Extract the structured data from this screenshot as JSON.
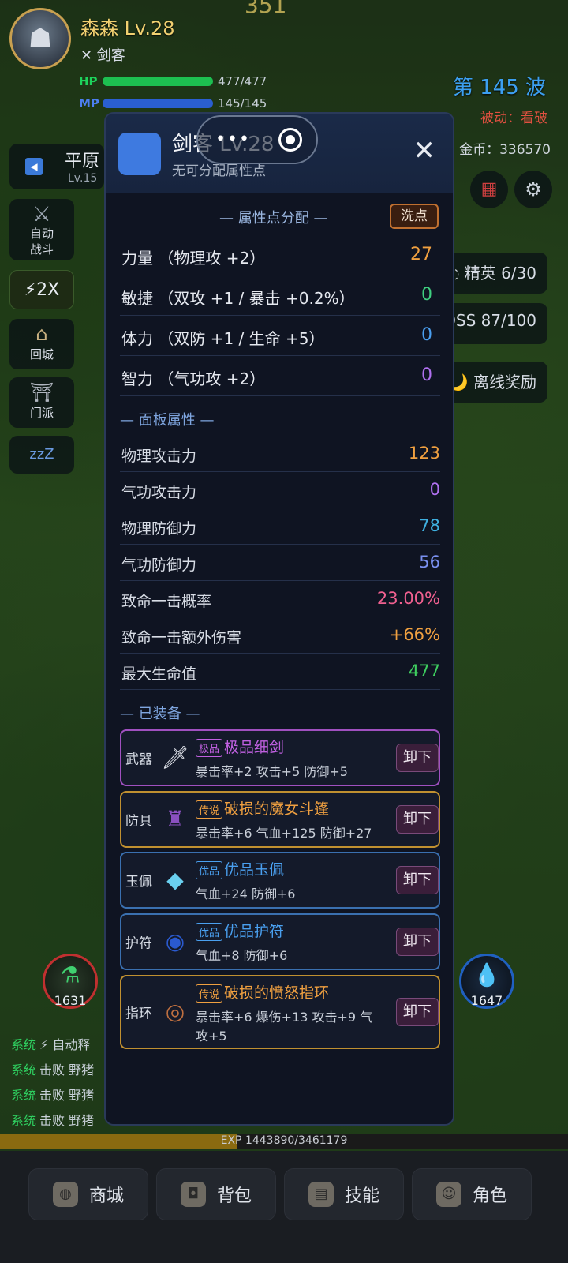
{
  "hud": {
    "gold_top": "351",
    "player_name": "森森 Lv.28",
    "player_class": "✕ 剑客",
    "hp_label": "HP",
    "hp_text": "477/477",
    "hp_fraction": 1.0,
    "mp_label": "MP",
    "mp_text": "145/145",
    "mp_fraction": 1.0,
    "wave": "第 145 波",
    "passive": "被动：看破",
    "coins": "金币：336570",
    "zone_name": "平原",
    "zone_level": "Lv.15"
  },
  "left_buttons": {
    "auto_battle": "自动\n战斗",
    "speed": "⚡2X",
    "return_city": "回城",
    "sect": "门派",
    "sleep": "zzZ"
  },
  "right_buttons": {
    "elite": "◌ 精英 6/30",
    "boss": "OSS 87/100",
    "offline": "🌙 离线奖励"
  },
  "potions": {
    "red_count": "1631",
    "blue_count": "1647"
  },
  "logs": [
    {
      "tag": "系统",
      "text": "⚡ 自动释"
    },
    {
      "tag": "系统",
      "text": "击败 野猪"
    },
    {
      "tag": "系统",
      "text": "击败 野猪"
    },
    {
      "tag": "系统",
      "text": "击败 野猪"
    }
  ],
  "exp": {
    "text": "EXP 1443890/3461179",
    "fraction": 0.417
  },
  "nav": [
    {
      "label": "商城",
      "icon": "bag-icon"
    },
    {
      "label": "背包",
      "icon": "backpack-icon"
    },
    {
      "label": "技能",
      "icon": "book-icon"
    },
    {
      "label": "角色",
      "icon": "person-icon"
    }
  ],
  "modal": {
    "title": "剑客 Lv.28",
    "subtitle": "无可分配属性点",
    "attr_section": "— 属性点分配 —",
    "wash_label": "洗点",
    "attrs": [
      {
        "label": "力量 （物理攻 +2）",
        "value": "27",
        "color": "#f0a040"
      },
      {
        "label": "敏捷 （双攻 +1 / 暴击 +0.2%）",
        "value": "0",
        "color": "#3fcf80"
      },
      {
        "label": "体力 （双防 +1 / 生命 +5）",
        "value": "0",
        "color": "#4a9ff0"
      },
      {
        "label": "智力 （气功攻 +2）",
        "value": "0",
        "color": "#b070f0"
      }
    ],
    "panel_section": "— 面板属性 —",
    "panel": [
      {
        "label": "物理攻击力",
        "value": "123",
        "color": "#f0a040"
      },
      {
        "label": "气功攻击力",
        "value": "0",
        "color": "#b070f0"
      },
      {
        "label": "物理防御力",
        "value": "78",
        "color": "#3fb0e0"
      },
      {
        "label": "气功防御力",
        "value": "56",
        "color": "#7a90f0"
      },
      {
        "label": "致命一击概率",
        "value": "23.00%",
        "color": "#f06090"
      },
      {
        "label": "致命一击额外伤害",
        "value": "+66%",
        "color": "#f0a040"
      },
      {
        "label": "最大生命值",
        "value": "477",
        "color": "#3fcf60"
      }
    ],
    "equip_section": "— 已装备 —",
    "unequip_label": "卸下",
    "equips": [
      {
        "slot": "武器",
        "icon": "dagger-icon",
        "rarity": "极品",
        "name": "极品细剑",
        "attrs": "暴击率+2  攻击+5  防御+5",
        "color": "#c060e0",
        "border": "#a050c0"
      },
      {
        "slot": "防具",
        "icon": "cloak-icon",
        "rarity": "传说",
        "name": "破损的魔女斗篷",
        "attrs": "暴击率+6  气血+125  防御+27",
        "color": "#f0a040",
        "border": "#c09030"
      },
      {
        "slot": "玉佩",
        "icon": "gem-icon",
        "rarity": "优品",
        "name": "优品玉佩",
        "attrs": "气血+24  防御+6",
        "color": "#4aa0f0",
        "border": "#3a70b0"
      },
      {
        "slot": "护符",
        "icon": "eye-charm-icon",
        "rarity": "优品",
        "name": "优品护符",
        "attrs": "气血+8  防御+6",
        "color": "#4aa0f0",
        "border": "#3a70b0"
      },
      {
        "slot": "指环",
        "icon": "ring-icon",
        "rarity": "传说",
        "name": "破损的愤怒指环",
        "attrs": "暴击率+6  爆伤+13  攻击+9  气攻+5",
        "color": "#f0a040",
        "border": "#c09030"
      }
    ]
  }
}
